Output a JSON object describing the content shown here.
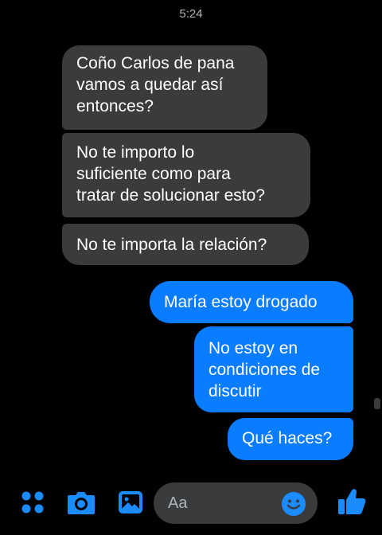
{
  "status": {
    "time": "5:24"
  },
  "conversation": {
    "messages": [
      {
        "direction": "incoming",
        "text": "Coño Carlos de pana\nvamos a quedar así\nentonces?"
      },
      {
        "direction": "incoming",
        "text": "No te importo lo\nsuficiente como para\ntratar de solucionar esto?"
      },
      {
        "direction": "incoming",
        "text": "No te importa la relación?"
      },
      {
        "direction": "outgoing",
        "text": "María estoy drogado"
      },
      {
        "direction": "outgoing",
        "text": "No estoy en\ncondiciones de\ndiscutir"
      },
      {
        "direction": "outgoing",
        "text": "Qué haces?"
      }
    ]
  },
  "composer": {
    "placeholder": "Aa",
    "icons": [
      "menu-dots-icon",
      "camera-icon",
      "gallery-icon",
      "emoji-icon",
      "thumbs-up-icon"
    ]
  },
  "colors": {
    "background": "#000000",
    "incoming_bubble": "#3a3b3c",
    "outgoing_bubble": "#0a7cff",
    "accent": "#1a8cff"
  }
}
